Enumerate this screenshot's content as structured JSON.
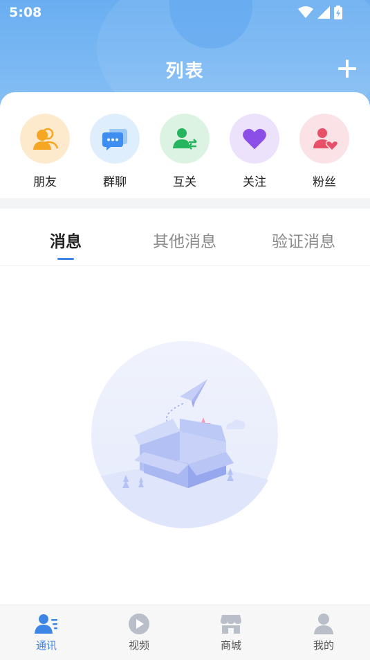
{
  "status_bar": {
    "time": "5:08"
  },
  "header": {
    "title": "列表"
  },
  "shortcuts": [
    {
      "label": "朋友",
      "icon": "friends-icon",
      "color": "#f5a623"
    },
    {
      "label": "群聊",
      "icon": "group-chat-icon",
      "color": "#3d8ef0"
    },
    {
      "label": "互关",
      "icon": "mutual-follow-icon",
      "color": "#27b45e"
    },
    {
      "label": "关注",
      "icon": "heart-icon",
      "color": "#8b4ee6"
    },
    {
      "label": "粉丝",
      "icon": "fans-icon",
      "color": "#e8506a"
    }
  ],
  "tabs": [
    {
      "label": "消息",
      "active": true
    },
    {
      "label": "其他消息",
      "active": false
    },
    {
      "label": "验证消息",
      "active": false
    }
  ],
  "bottom_nav": [
    {
      "label": "通讯",
      "icon": "contacts-icon",
      "active": true
    },
    {
      "label": "视频",
      "icon": "video-icon",
      "active": false
    },
    {
      "label": "商城",
      "icon": "shop-icon",
      "active": false
    },
    {
      "label": "我的",
      "icon": "profile-icon",
      "active": false
    }
  ],
  "colors": {
    "accent": "#3d86e6",
    "header": "#6aaef1"
  }
}
